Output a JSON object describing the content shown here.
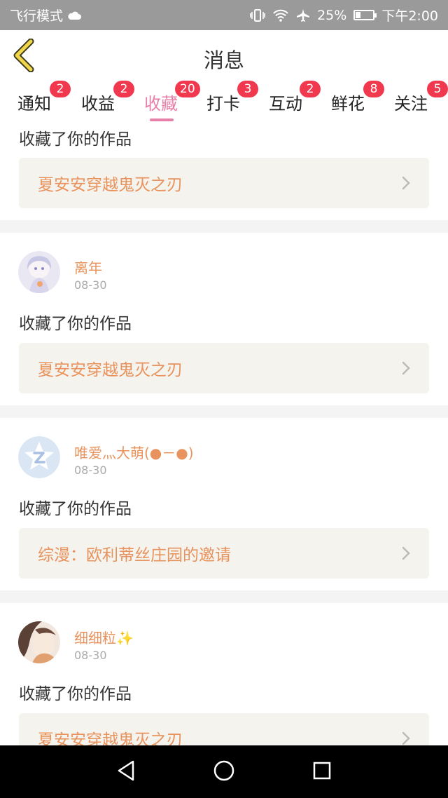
{
  "status_bar": {
    "left_text": "飞行模式",
    "battery_percent": "25%",
    "time": "下午2:00",
    "icons": [
      "cloud-icon",
      "vibrate-icon",
      "wifi-icon",
      "airplane-icon",
      "battery-icon"
    ],
    "battery_level": 0.25
  },
  "header": {
    "title": "消息"
  },
  "tabs": [
    {
      "label": "通知",
      "badge": "2"
    },
    {
      "label": "收益",
      "badge": "2"
    },
    {
      "label": "收藏",
      "badge": "20",
      "active": true
    },
    {
      "label": "打卡",
      "badge": "3"
    },
    {
      "label": "互动",
      "badge": "2"
    },
    {
      "label": "鲜花",
      "badge": "8"
    },
    {
      "label": "关注",
      "badge": "5"
    }
  ],
  "feed": [
    {
      "action": "收藏了你的作品",
      "work_title": "夏安安穿越鬼灭之刃"
    },
    {
      "username": "离年",
      "date": "08-30",
      "action": "收藏了你的作品",
      "work_title": "夏安安穿越鬼灭之刃"
    },
    {
      "username": "唯爱灬大萌(●－●)",
      "date": "08-30",
      "action": "收藏了你的作品",
      "work_title": "综漫：欧利蒂丝庄园的邀请"
    },
    {
      "username": "细细粒✨",
      "date": "08-30",
      "action": "收藏了你的作品",
      "work_title": "夏安安穿越鬼灭之刃"
    }
  ],
  "colors": {
    "accent_pink": "#e77fa8",
    "badge_red": "#f0394f",
    "link_orange": "#e8935d",
    "status_bar_gray": "#9a9a9a"
  }
}
